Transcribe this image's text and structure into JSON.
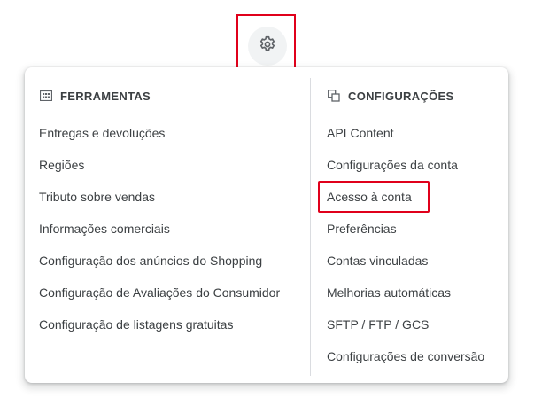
{
  "gear": {
    "icon": "gear-icon"
  },
  "tools": {
    "icon": "grid-table-icon",
    "title": "FERRAMENTAS",
    "items": [
      "Entregas e devoluções",
      "Regiões",
      "Tributo sobre vendas",
      "Informações comerciais",
      "Configuração dos anúncios do Shopping",
      "Configuração de Avaliações do Consumidor",
      "Configuração de listagens gratuitas"
    ]
  },
  "settings": {
    "icon": "copy-stack-icon",
    "title": "CONFIGURAÇÕES",
    "items": [
      "API Content",
      "Configurações da conta",
      "Acesso à conta",
      "Preferências",
      "Contas vinculadas",
      "Melhorias automáticas",
      "SFTP / FTP / GCS",
      "Configurações de conversão"
    ]
  },
  "colors": {
    "highlight": "#e0001b",
    "text": "#3c4043",
    "divider": "#dadce0"
  }
}
